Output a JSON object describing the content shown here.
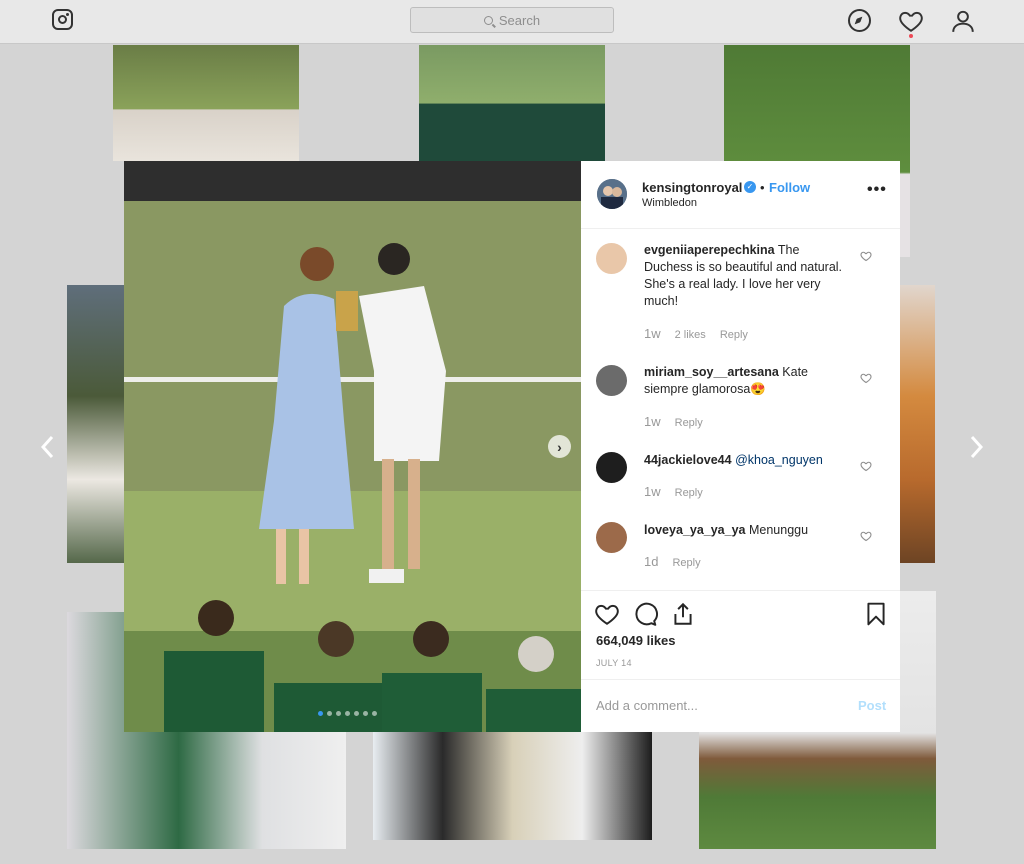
{
  "nav": {
    "search_placeholder": "Search"
  },
  "post": {
    "username": "kensingtonroyal",
    "separator": "•",
    "follow_label": "Follow",
    "location": "Wimbledon",
    "more_label": "•••",
    "likes": "664,049 likes",
    "date": "JULY 14",
    "add_comment_placeholder": "Add a comment...",
    "post_label": "Post",
    "carousel_total": 7,
    "carousel_active": 1
  },
  "comments": [
    {
      "user": "evgeniiaperepechkina",
      "text": "The Duchess is so beautiful and natural. She's a real lady. I love her very much!",
      "age": "1w",
      "likes": "2 likes",
      "reply": "Reply",
      "avatar_color": "#e9c7a9"
    },
    {
      "user": "miriam_soy__artesana",
      "text": "Kate siempre glamorosa😍",
      "age": "1w",
      "reply": "Reply",
      "avatar_color": "#6b6b6b"
    },
    {
      "user": "44jackielove44",
      "mention": "@khoa_nguyen",
      "age": "1w",
      "reply": "Reply",
      "avatar_color": "#1e1e1e"
    },
    {
      "user": "loveya_ya_ya_ya",
      "text": "Menunggu",
      "age": "1d",
      "reply": "Reply",
      "avatar_color": "#9c6a4a"
    }
  ],
  "colors": {
    "accent": "#3897f0",
    "post_disabled": "#b2dffc",
    "backdrop": "#d4d4d4"
  }
}
